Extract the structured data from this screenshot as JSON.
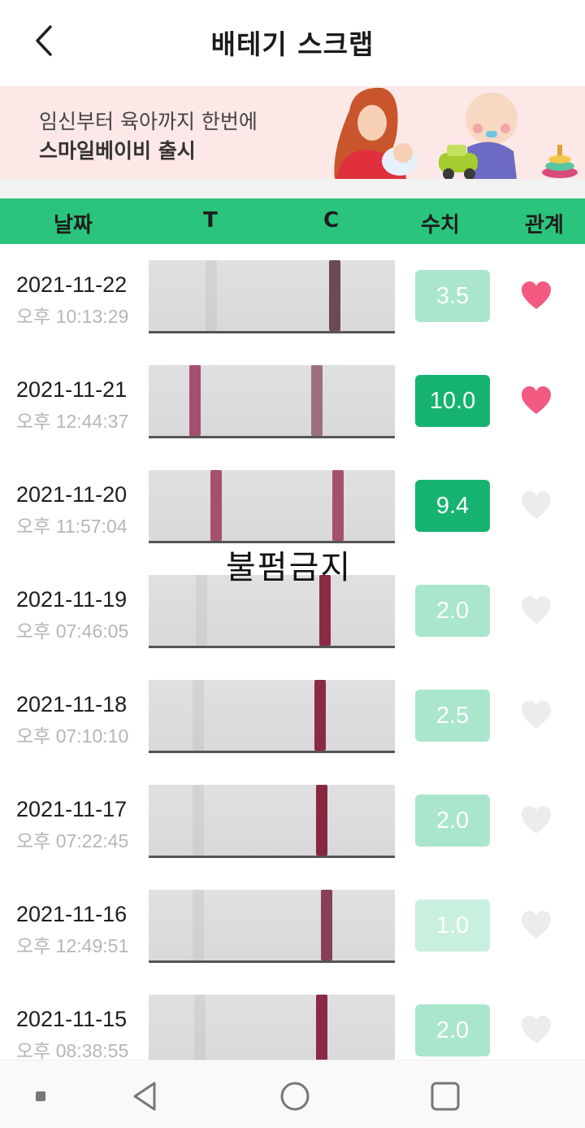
{
  "header": {
    "title": "배테기 스크랩"
  },
  "banner": {
    "line1": "임신부터 육아까지 한번에",
    "line2": "스마일베이비 출시"
  },
  "columns": {
    "date": "날짜",
    "t": "T",
    "c": "C",
    "value": "수치",
    "relation": "관계"
  },
  "watermark": "불펌금지",
  "colors": {
    "accent": "#2bc47c",
    "value_dark": "#15b36f",
    "heart_active": "#f25a82",
    "heart_inactive": "#ececec"
  },
  "rows": [
    {
      "date": "2021-11-22",
      "time": "오후 10:13:29",
      "value": "3.5",
      "value_style": "light",
      "heart": "active"
    },
    {
      "date": "2021-11-21",
      "time": "오후 12:44:37",
      "value": "10.0",
      "value_style": "dark",
      "heart": "active"
    },
    {
      "date": "2021-11-20",
      "time": "오후 11:57:04",
      "value": "9.4",
      "value_style": "dark",
      "heart": "inactive"
    },
    {
      "date": "2021-11-19",
      "time": "오후 07:46:05",
      "value": "2.0",
      "value_style": "light",
      "heart": "inactive"
    },
    {
      "date": "2021-11-18",
      "time": "오후 07:10:10",
      "value": "2.5",
      "value_style": "light",
      "heart": "inactive"
    },
    {
      "date": "2021-11-17",
      "time": "오후 07:22:45",
      "value": "2.0",
      "value_style": "light",
      "heart": "inactive"
    },
    {
      "date": "2021-11-16",
      "time": "오후 12:49:51",
      "value": "1.0",
      "value_style": "lighter",
      "heart": "inactive"
    },
    {
      "date": "2021-11-15",
      "time": "오후 08:38:55",
      "value": "2.0",
      "value_style": "light",
      "heart": "inactive"
    }
  ]
}
